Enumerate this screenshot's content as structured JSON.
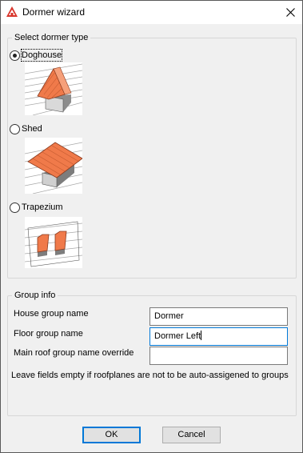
{
  "window": {
    "title": "Dormer wizard",
    "close_label": "✕"
  },
  "dormer_type": {
    "legend": "Select dormer type",
    "options": [
      {
        "label": "Doghouse",
        "checked": true
      },
      {
        "label": "Shed",
        "checked": false
      },
      {
        "label": "Trapezium",
        "checked": false
      }
    ]
  },
  "group_info": {
    "legend": "Group info",
    "fields": [
      {
        "label": "House group name",
        "value": "Dormer"
      },
      {
        "label": "Floor group name",
        "value": "Dormer Left"
      },
      {
        "label": "Main roof group name override",
        "value": ""
      }
    ],
    "note": "Leave fields empty if roofplanes are not to be auto-assigened to groups"
  },
  "buttons": {
    "ok_label": "OK",
    "cancel_label": "Cancel"
  },
  "colors": {
    "roof_accent": "#f07a4a",
    "focus_border": "#0078d7"
  }
}
